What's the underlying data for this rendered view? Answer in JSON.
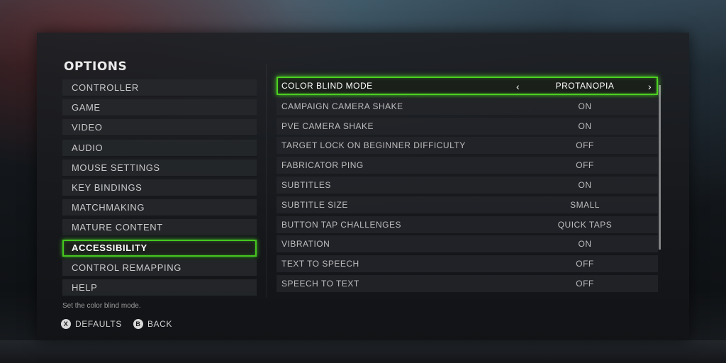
{
  "header": {
    "title": "OPTIONS"
  },
  "menu": {
    "items": [
      {
        "label": "CONTROLLER"
      },
      {
        "label": "GAME"
      },
      {
        "label": "VIDEO"
      },
      {
        "label": "AUDIO"
      },
      {
        "label": "MOUSE SETTINGS"
      },
      {
        "label": "KEY BINDINGS"
      },
      {
        "label": "MATCHMAKING"
      },
      {
        "label": "MATURE CONTENT"
      },
      {
        "label": "ACCESSIBILITY",
        "selected": true
      },
      {
        "label": "CONTROL REMAPPING"
      },
      {
        "label": "HELP"
      }
    ]
  },
  "settings": {
    "rows": [
      {
        "label": "COLOR BLIND MODE",
        "value": "PROTANOPIA",
        "focused": true
      },
      {
        "label": "CAMPAIGN CAMERA SHAKE",
        "value": "ON"
      },
      {
        "label": "PVE CAMERA SHAKE",
        "value": "ON"
      },
      {
        "label": "TARGET LOCK ON BEGINNER DIFFICULTY",
        "value": "OFF"
      },
      {
        "label": "FABRICATOR PING",
        "value": "OFF"
      },
      {
        "label": "SUBTITLES",
        "value": "ON"
      },
      {
        "label": "SUBTITLE SIZE",
        "value": "SMALL"
      },
      {
        "label": "BUTTON TAP CHALLENGES",
        "value": "QUICK TAPS"
      },
      {
        "label": "VIBRATION",
        "value": "ON"
      },
      {
        "label": "TEXT TO SPEECH",
        "value": "OFF"
      },
      {
        "label": "SPEECH TO TEXT",
        "value": "OFF"
      }
    ],
    "chevron_left": "‹",
    "chevron_right": "›"
  },
  "hint": {
    "text": "Set the color blind mode."
  },
  "footer": {
    "defaults": {
      "glyph": "X",
      "label": "DEFAULTS"
    },
    "back": {
      "glyph": "B",
      "label": "BACK"
    }
  },
  "colors": {
    "accent": "#4cd022",
    "text": "#c9c9c9"
  }
}
